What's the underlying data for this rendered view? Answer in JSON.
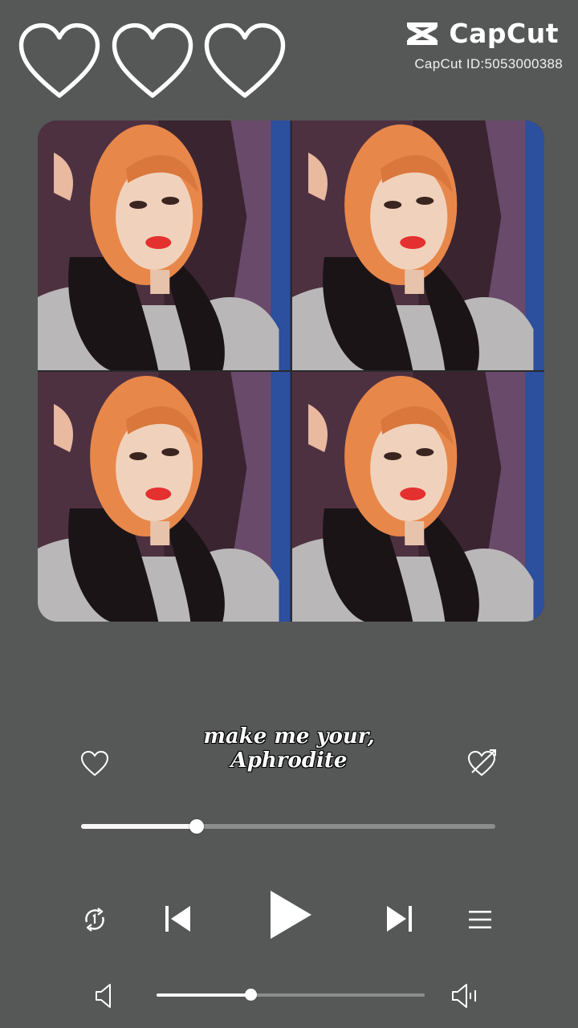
{
  "brand": {
    "name": "CapCut",
    "id_text": "CapCut ID:5053000388"
  },
  "lyrics": {
    "line1": "make me your,",
    "line2": "Aphrodite"
  },
  "player": {
    "progress_fraction": 0.28,
    "volume_fraction": 0.35,
    "elapsed_time": "",
    "remaining_time": ""
  },
  "icons": {
    "top": [
      "heart-outline-icon",
      "heart-outline-icon",
      "heart-outline-icon"
    ],
    "controls": [
      "repeat-icon",
      "previous-icon",
      "play-icon",
      "next-icon",
      "playlist-icon"
    ],
    "volume": [
      "volume-low-icon",
      "volume-high-icon"
    ],
    "like": "heart-icon",
    "dislike": "heart-crossed-icon"
  },
  "colors": {
    "background": "#565857",
    "track": "#8c8e8d",
    "fill": "#f7f7f7",
    "hair": "#e8874a"
  }
}
